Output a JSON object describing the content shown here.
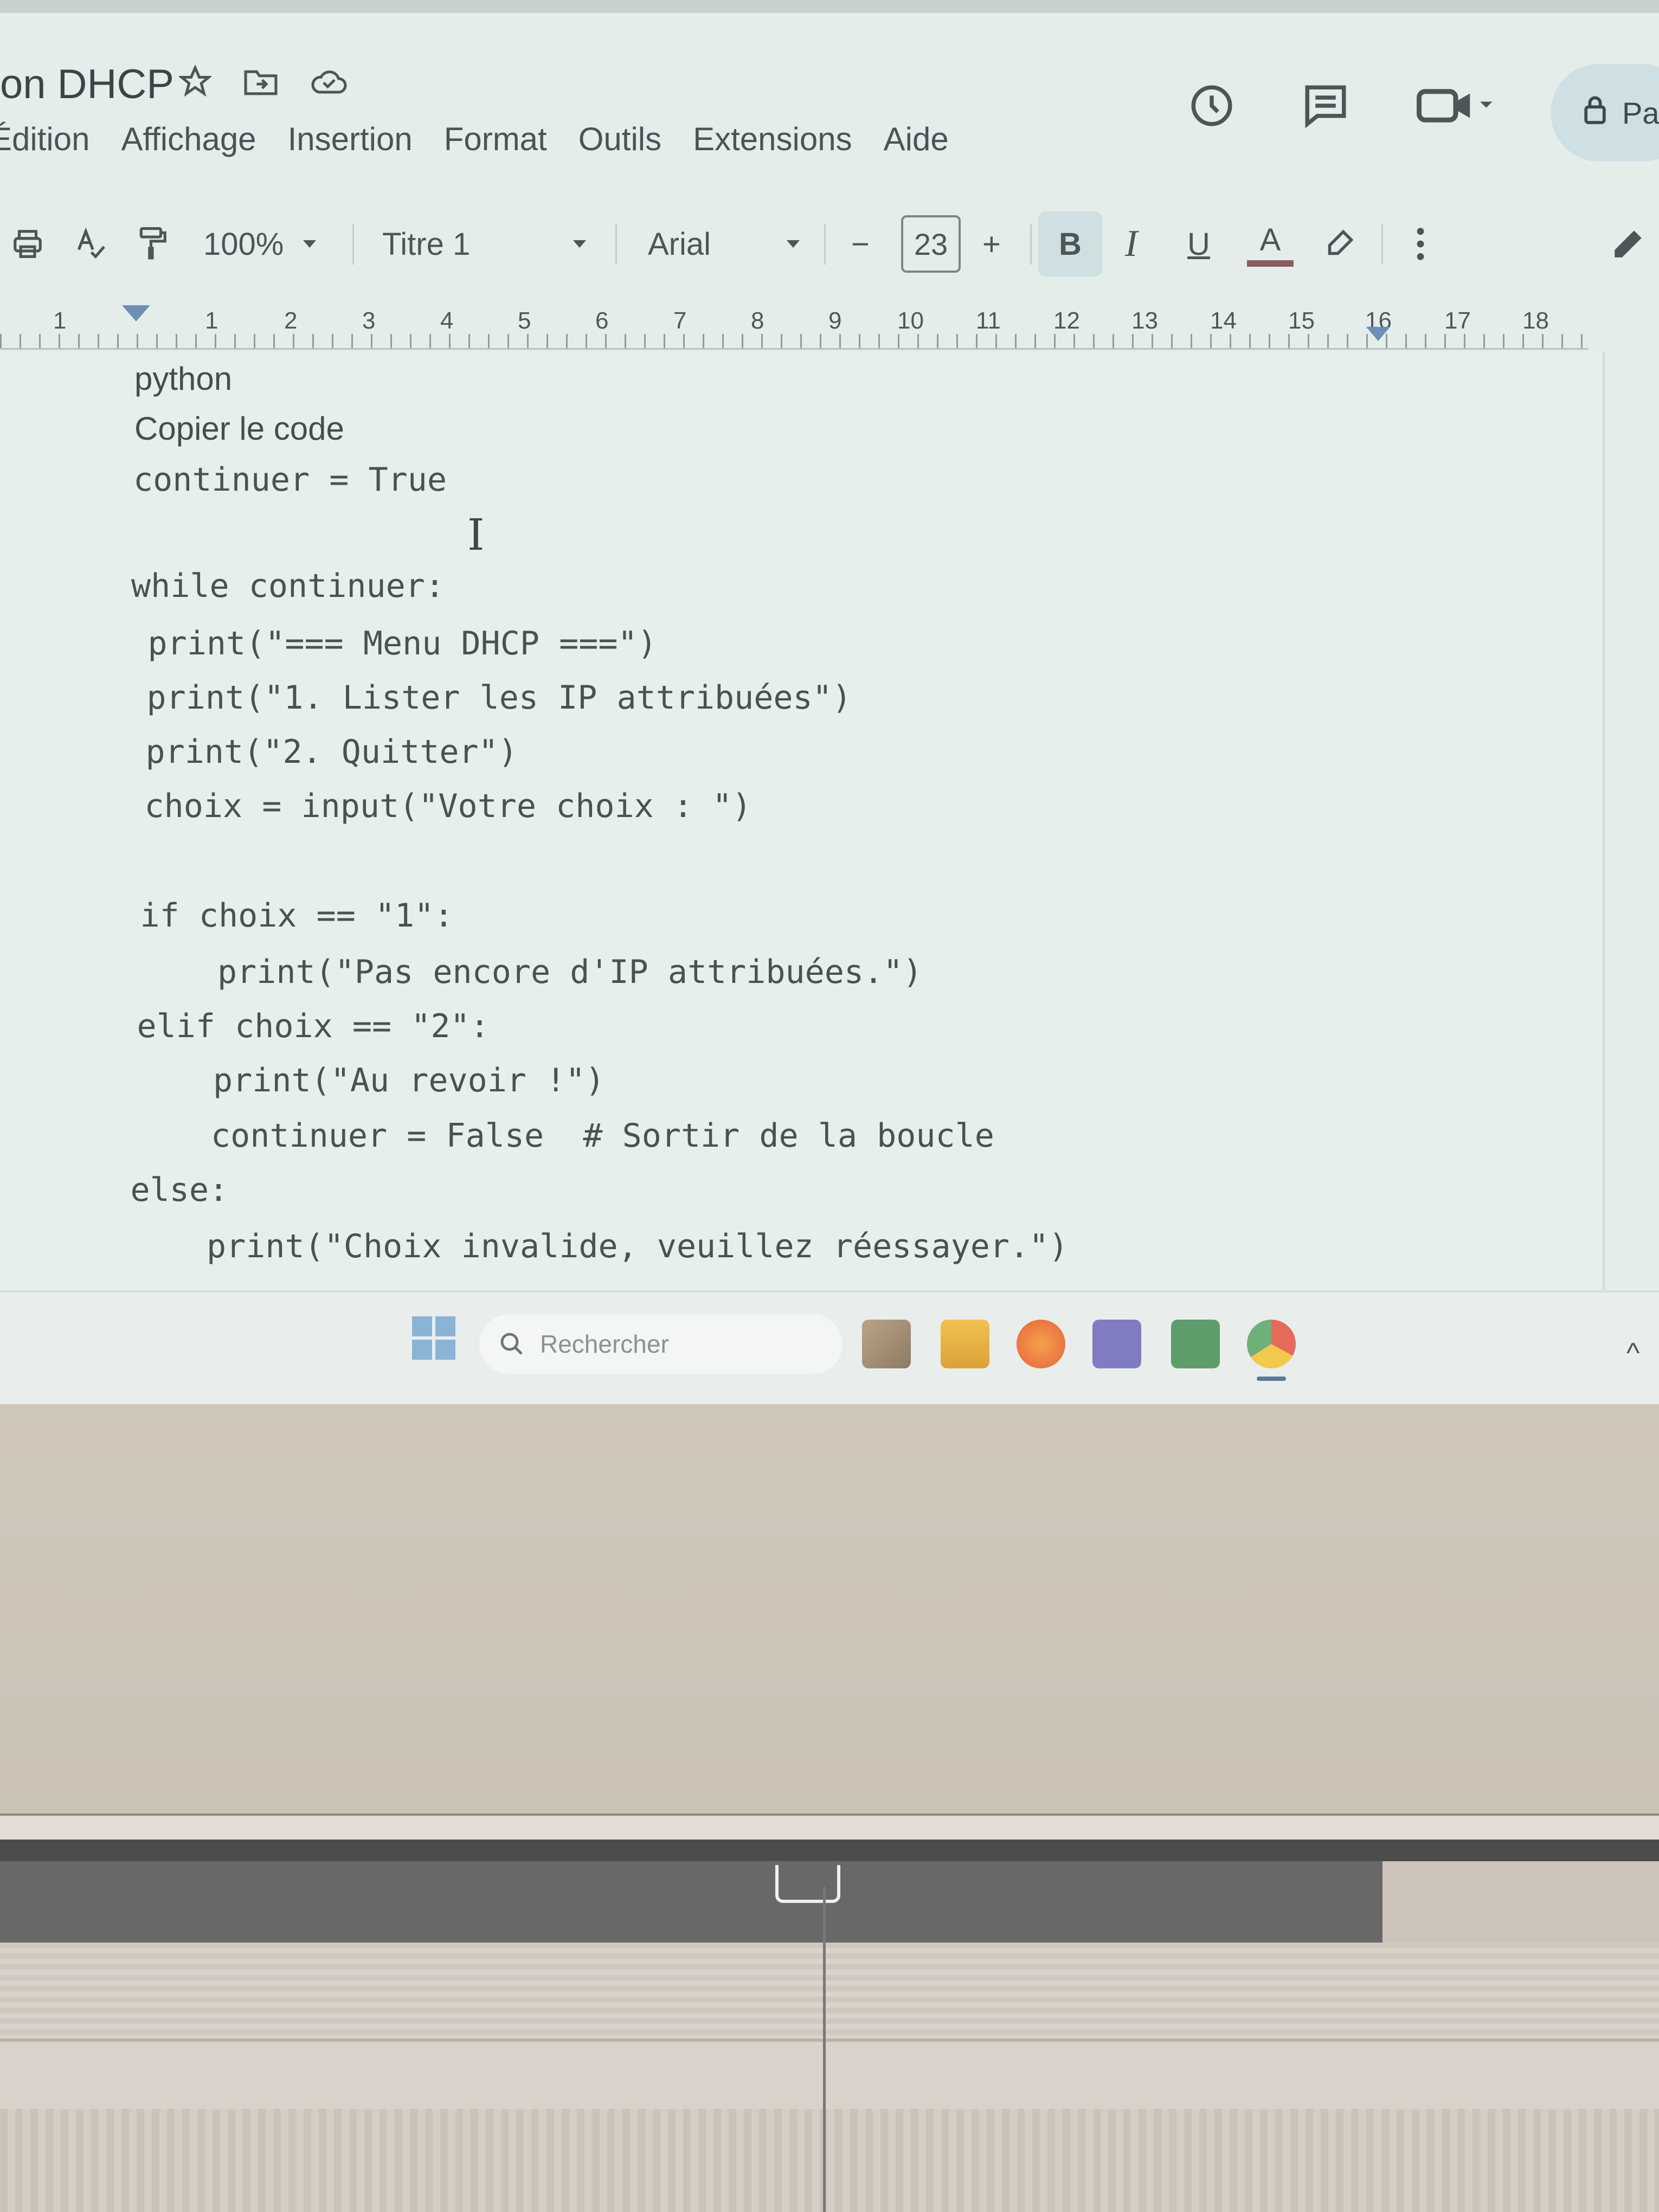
{
  "document": {
    "title": "on DHCP",
    "menus": [
      "Édition",
      "Affichage",
      "Insertion",
      "Format",
      "Outils",
      "Extensions",
      "Aide"
    ],
    "share_label": "Pa"
  },
  "toolbar": {
    "zoom": "100%",
    "style": "Titre 1",
    "font": "Arial",
    "minus": "−",
    "font_size": "23",
    "plus": "+",
    "bold": "B",
    "italic": "I",
    "underline": "U",
    "text_color": "A"
  },
  "ruler": {
    "numbers": [
      "1",
      "1",
      "2",
      "3",
      "4",
      "5",
      "6",
      "7",
      "8",
      "9",
      "10",
      "11",
      "12",
      "13",
      "14",
      "15",
      "16",
      "17",
      "18"
    ]
  },
  "content": {
    "lang_label": "python",
    "copy_label": "Copier le code",
    "code_lines": [
      "continuer = True",
      "",
      "while continuer:",
      "    print(\"=== Menu DHCP ===\")",
      "    print(\"1. Lister les IP attribuées\")",
      "    print(\"2. Quitter\")",
      "    choix = input(\"Votre choix : \")",
      "",
      "    if choix == \"1\":",
      "        print(\"Pas encore d'IP attribuées.\")",
      "    elif choix == \"2\":",
      "        print(\"Au revoir !\")",
      "        continuer = False  # Sortir de la boucle",
      "    else:",
      "        print(\"Choix invalide, veuillez réessayer.\")"
    ]
  },
  "taskbar": {
    "search_placeholder": "Rechercher"
  },
  "colors": {
    "screen_bg": "#e4ede9",
    "toolbar_active": "#cfe0e3",
    "text": "#4a5151",
    "wall": "#ccc4ba"
  }
}
